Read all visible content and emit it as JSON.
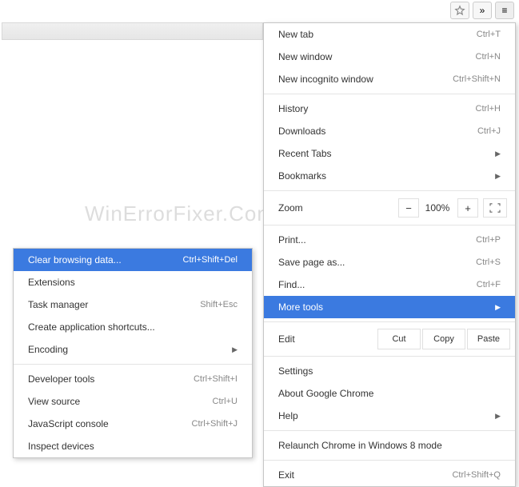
{
  "topbar": {
    "star": "star-icon",
    "chev": "»",
    "menu": "≡"
  },
  "watermark": "WinErrorFixer.Com",
  "main_menu": {
    "newtab": {
      "label": "New tab",
      "shortcut": "Ctrl+T"
    },
    "newwin": {
      "label": "New window",
      "shortcut": "Ctrl+N"
    },
    "incognito": {
      "label": "New incognito window",
      "shortcut": "Ctrl+Shift+N"
    },
    "history": {
      "label": "History",
      "shortcut": "Ctrl+H"
    },
    "downloads": {
      "label": "Downloads",
      "shortcut": "Ctrl+J"
    },
    "recenttabs": {
      "label": "Recent Tabs"
    },
    "bookmarks": {
      "label": "Bookmarks"
    },
    "zoom": {
      "label": "Zoom",
      "minus": "−",
      "pct": "100%",
      "plus": "+"
    },
    "print": {
      "label": "Print...",
      "shortcut": "Ctrl+P"
    },
    "savepage": {
      "label": "Save page as...",
      "shortcut": "Ctrl+S"
    },
    "find": {
      "label": "Find...",
      "shortcut": "Ctrl+F"
    },
    "moretools": {
      "label": "More tools"
    },
    "edit": {
      "label": "Edit",
      "cut": "Cut",
      "copy": "Copy",
      "paste": "Paste"
    },
    "settings": {
      "label": "Settings"
    },
    "about": {
      "label": "About Google Chrome"
    },
    "help": {
      "label": "Help"
    },
    "relaunch": {
      "label": "Relaunch Chrome in Windows 8 mode"
    },
    "exit": {
      "label": "Exit",
      "shortcut": "Ctrl+Shift+Q"
    }
  },
  "sub_menu": {
    "clearbrowsing": {
      "label": "Clear browsing data...",
      "shortcut": "Ctrl+Shift+Del"
    },
    "extensions": {
      "label": "Extensions"
    },
    "taskmgr": {
      "label": "Task manager",
      "shortcut": "Shift+Esc"
    },
    "appshort": {
      "label": "Create application shortcuts..."
    },
    "encoding": {
      "label": "Encoding"
    },
    "devtools": {
      "label": "Developer tools",
      "shortcut": "Ctrl+Shift+I"
    },
    "viewsource": {
      "label": "View source",
      "shortcut": "Ctrl+U"
    },
    "jsconsole": {
      "label": "JavaScript console",
      "shortcut": "Ctrl+Shift+J"
    },
    "inspect": {
      "label": "Inspect devices"
    }
  }
}
